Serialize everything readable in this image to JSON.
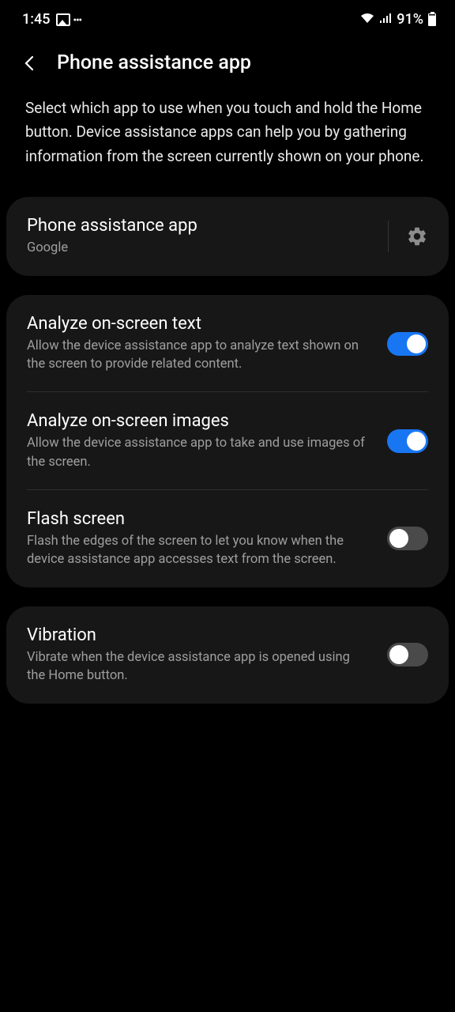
{
  "statusBar": {
    "time": "1:45",
    "battery": "91%"
  },
  "header": {
    "title": "Phone assistance app"
  },
  "description": "Select which app to use when you touch and hold the Home button. Device assistance apps can help you by gathering information from the screen currently shown on your phone.",
  "assistApp": {
    "title": "Phone assistance app",
    "value": "Google"
  },
  "settings": {
    "analyzeText": {
      "title": "Analyze on-screen text",
      "subtitle": "Allow the device assistance app to analyze text shown on the screen to provide related content.",
      "enabled": true
    },
    "analyzeImages": {
      "title": "Analyze on-screen images",
      "subtitle": "Allow the device assistance app to take and use images of the screen.",
      "enabled": true
    },
    "flashScreen": {
      "title": "Flash screen",
      "subtitle": "Flash the edges of the screen to let you know when the device assistance app accesses text from the screen.",
      "enabled": false
    },
    "vibration": {
      "title": "Vibration",
      "subtitle": "Vibrate when the device assistance app is opened using the Home button.",
      "enabled": false
    }
  }
}
